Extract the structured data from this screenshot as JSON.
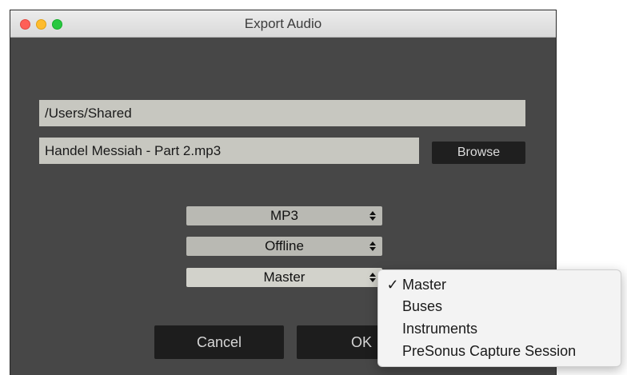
{
  "window": {
    "title": "Export Audio"
  },
  "path_field": {
    "value": "/Users/Shared"
  },
  "filename_field": {
    "value": "Handel Messiah - Part 2.mp3"
  },
  "browse_button": {
    "label": "Browse"
  },
  "format_select": {
    "value": "MP3"
  },
  "mode_select": {
    "value": "Offline"
  },
  "source_select": {
    "value": "Master"
  },
  "buttons": {
    "cancel": "Cancel",
    "ok": "OK"
  },
  "source_menu": {
    "check_glyph": "✓",
    "items": [
      {
        "label": "Master",
        "checked": true
      },
      {
        "label": "Buses",
        "checked": false
      },
      {
        "label": "Instruments",
        "checked": false
      },
      {
        "label": "PreSonus Capture Session",
        "checked": false
      }
    ]
  },
  "colors": {
    "window_bg": "#474747",
    "field_bg": "#c7c7c0",
    "button_bg": "#1d1d1d",
    "traffic_close": "#ff5f57",
    "traffic_minimize": "#febc2e",
    "traffic_maximize": "#28c840"
  }
}
